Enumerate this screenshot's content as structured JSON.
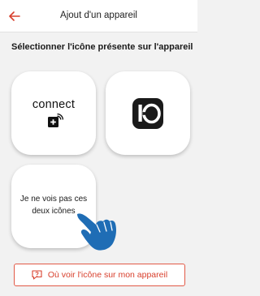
{
  "header": {
    "title": "Ajout d'un appareil",
    "back_icon": "arrow-left-icon"
  },
  "instruction": "Sélectionner l'icône présente sur l'appareil",
  "options": {
    "connect": {
      "label": "connect",
      "icon": "connect-plus-signal-icon"
    },
    "io": {
      "icon": "io-logo-icon"
    },
    "none": {
      "label": "Je ne vois pas ces deux icônes",
      "icon": "pointing-hand-icon"
    }
  },
  "help_button": {
    "label": "Où voir l'icône sur mon appareil",
    "icon": "question-message-icon"
  },
  "colors": {
    "accent": "#d8402d",
    "hand": "#1f6db5",
    "background": "#f2f2f2"
  }
}
